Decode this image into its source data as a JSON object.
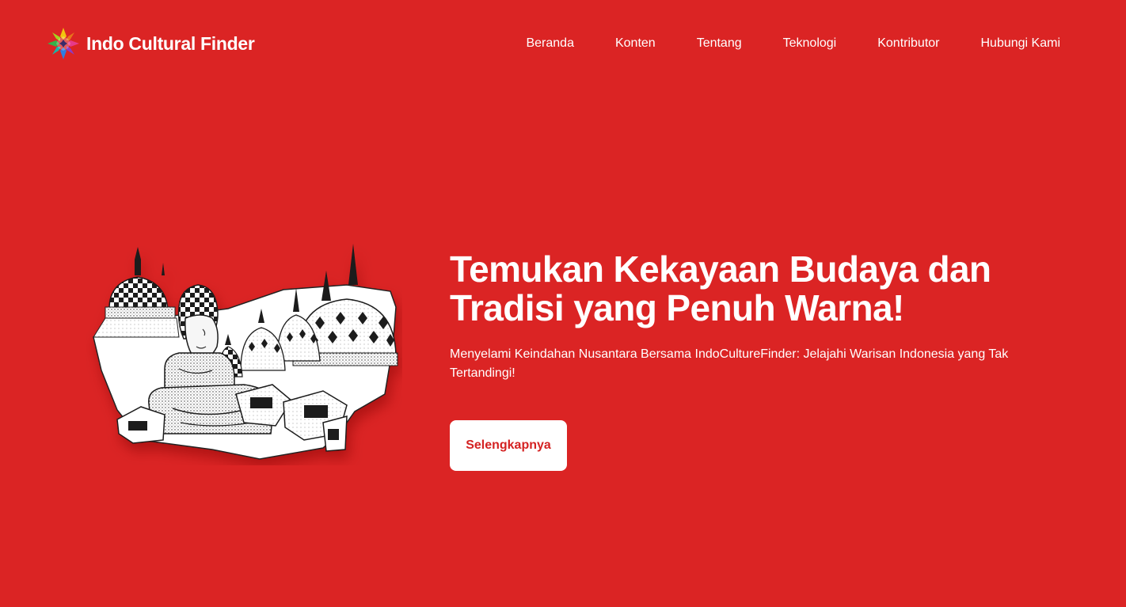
{
  "header": {
    "brand_name": "Indo Cultural Finder",
    "logo_icon": "colorful-flower-logo-icon",
    "nav": [
      {
        "label": "Beranda"
      },
      {
        "label": "Konten"
      },
      {
        "label": "Tentang"
      },
      {
        "label": "Teknologi"
      },
      {
        "label": "Kontributor"
      },
      {
        "label": "Hubungi Kami"
      }
    ]
  },
  "hero": {
    "title_line1": "Temukan Kekayaan Budaya dan",
    "title_line2": "Tradisi yang Penuh Warna!",
    "subtitle": "Menyelami Keindahan Nusantara Bersama IndoCultureFinder: Jelajahi Warisan Indonesia yang Tak Tertandingi!",
    "cta_label": "Selengkapnya",
    "illustration": "borobudur-buddha-stupa-illustration"
  },
  "colors": {
    "background": "#db2424",
    "text": "#ffffff",
    "button_bg": "#ffffff",
    "button_text": "#d42222"
  }
}
